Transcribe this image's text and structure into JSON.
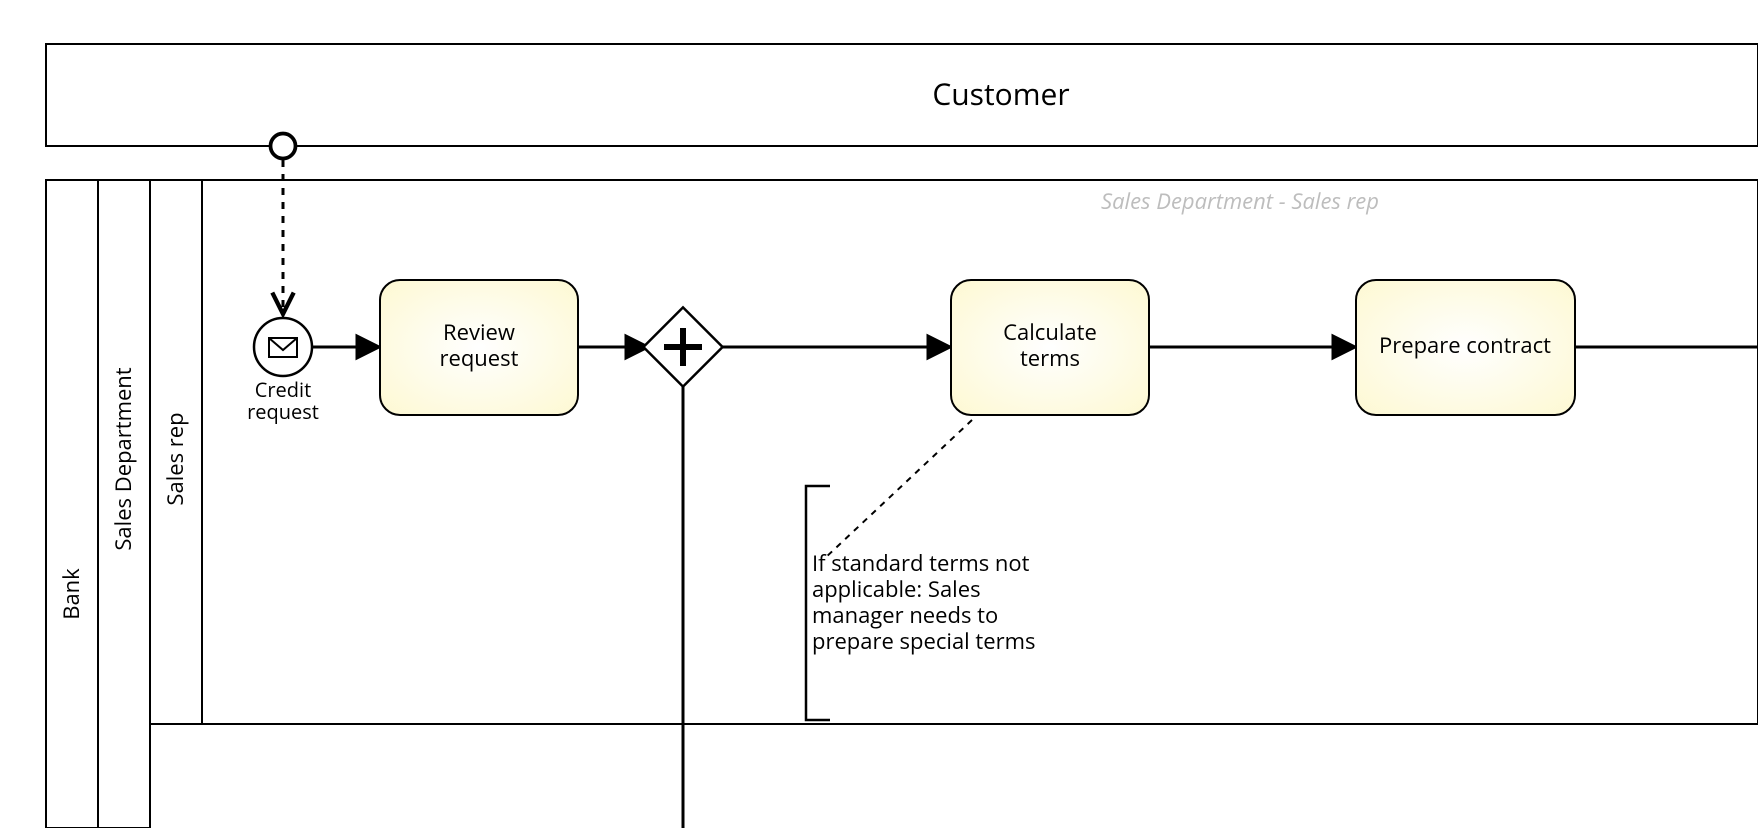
{
  "participants": {
    "customer": {
      "title": "Customer"
    },
    "bank": {
      "title": "Bank",
      "lanes": {
        "sales_dept": {
          "title": "Sales Department",
          "sublanes": {
            "sales_rep": {
              "title": "Sales rep",
              "caption": "Sales Department - Sales rep"
            }
          }
        }
      }
    }
  },
  "events": {
    "credit_request": {
      "label_line1": "Credit",
      "label_line2": "request"
    }
  },
  "tasks": {
    "review_request": {
      "line1": "Review",
      "line2": "request"
    },
    "calculate_terms": {
      "line1": "Calculate",
      "line2": "terms"
    },
    "prepare_contract": {
      "line1": "Prepare contract"
    }
  },
  "annotation": {
    "line1": "If standard terms not",
    "line2": "applicable: Sales",
    "line3": "manager needs to",
    "line4": "prepare special terms"
  }
}
